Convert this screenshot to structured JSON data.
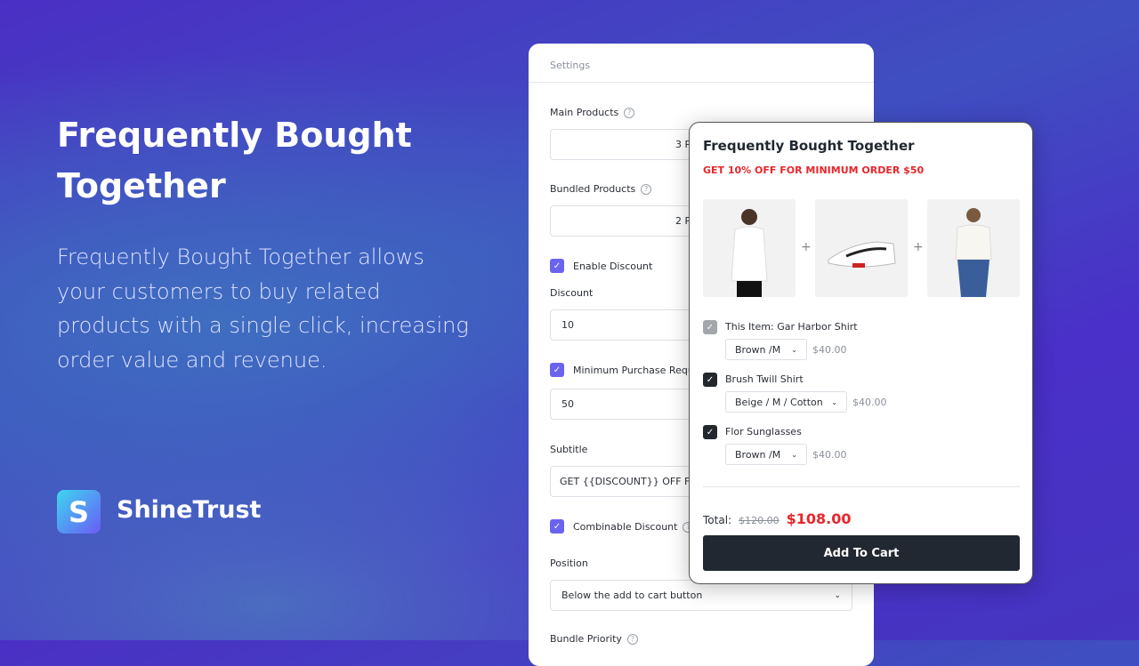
{
  "hero": {
    "title": "Frequently Bought Together",
    "description": "Frequently Bought Together allows your customers to buy related products with a single click, increasing order value and revenue."
  },
  "brand": {
    "name": "ShineTrust",
    "logo_letter": "S"
  },
  "settings": {
    "header": "Settings",
    "main_products": {
      "label": "Main Products",
      "value": "3 Products"
    },
    "bundled_products": {
      "label": "Bundled Products",
      "value": "2 Products"
    },
    "enable_discount": {
      "label": "Enable Discount",
      "checked": true
    },
    "discount": {
      "label": "Discount",
      "value": "10"
    },
    "minimum_purchase": {
      "label": "Minimum Purchase Requirement",
      "checked": true,
      "value": "50"
    },
    "subtitle": {
      "label": "Subtitle",
      "value": "GET {{DISCOUNT}} OFF FOR MINIMUM ORDER {{MINIMUM}}"
    },
    "combinable_discount": {
      "label": "Combinable Discount",
      "checked": true
    },
    "position": {
      "label": "Position",
      "value": "Below the add to cart button"
    },
    "bundle_priority": {
      "label": "Bundle Priority"
    }
  },
  "widget": {
    "title": "Frequently Bought Together",
    "subtitle": "GET 10% OFF FOR MINIMUM ORDER $50",
    "items": [
      {
        "name": "This Item: Gar Harbor Shirt",
        "variant": "Brown /M",
        "price": "$40.00",
        "checked": true,
        "disabled": true
      },
      {
        "name": "Brush Twill Shirt",
        "variant": "Beige / M / Cotton",
        "price": "$40.00",
        "checked": true
      },
      {
        "name": "Flor Sunglasses",
        "variant": "Brown /M",
        "price": "$40.00",
        "checked": true
      }
    ],
    "total_label": "Total:",
    "original_total": "$120.00",
    "discounted_total": "$108.00",
    "add_to_cart": "Add To Cart",
    "accent": "#e8262b"
  },
  "colors": {
    "checkbox": "#6b63f0",
    "dark": "#222831"
  }
}
